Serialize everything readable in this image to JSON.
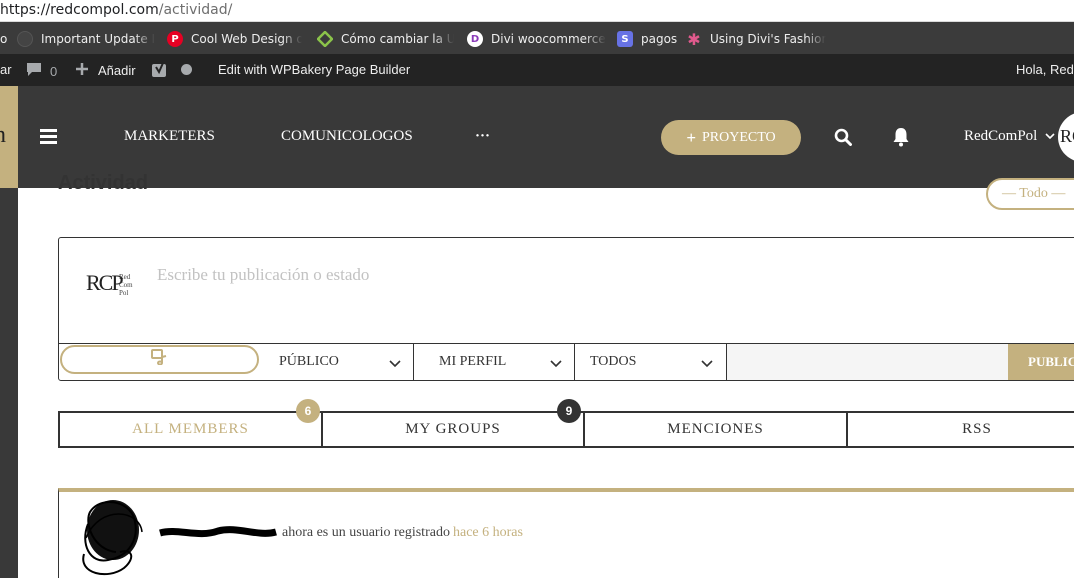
{
  "browser": {
    "url_host": "https://redcompol.com",
    "url_path": "/actividad/",
    "bookmarks": [
      {
        "label": "Important Update Inf",
        "icon": "shield-icon"
      },
      {
        "label": "Cool Web Design on",
        "icon": "pinterest-icon"
      },
      {
        "label": "Cómo cambiar la URL",
        "icon": "diamond-icon"
      },
      {
        "label": "Divi woocommerce la",
        "icon": "divi-icon"
      },
      {
        "label": "pagos",
        "icon": "stripe-icon"
      },
      {
        "label": "Using Divi's Fashion L",
        "icon": "star-icon"
      }
    ],
    "bookmark_leading": "o"
  },
  "admin_bar": {
    "cut_label": "ar",
    "comments_count": "0",
    "add_label": "Añadir",
    "wpbakery_label": "Edit with WPBakery Page Builder",
    "greeting": "Hola, RedC"
  },
  "header": {
    "logo_letter": "n",
    "nav": [
      "MARKETERS",
      "COMUNICOLOGOS",
      "···"
    ],
    "project_button": "PROYECTO",
    "user_name": "RedComPol",
    "avatar_text": "RC"
  },
  "page": {
    "title": "Actividad",
    "filter_label": "— Todo —"
  },
  "post_box": {
    "logo_big": "RCP",
    "logo_small": [
      "Red",
      "Com",
      "Pol"
    ],
    "placeholder": "Escribe tu publicación o estado",
    "privacy": "PÚBLICO",
    "post_in": "MI PERFIL",
    "audience": "TODOS",
    "publish_label": "PUBLICAR"
  },
  "tabs": [
    {
      "label": "ALL MEMBERS",
      "badge": "6"
    },
    {
      "label": "MY GROUPS",
      "badge": "9"
    },
    {
      "label": "MENCIONES",
      "badge": ""
    },
    {
      "label": "RSS",
      "badge": ""
    }
  ],
  "activity": [
    {
      "text": "ahora es un usuario registrado",
      "time": "hace 6 horas"
    }
  ],
  "colors": {
    "accent": "#c4b17f",
    "header_bg": "#393939",
    "admin_bg": "#232323",
    "bookmark_bg": "#3b3b3b"
  }
}
